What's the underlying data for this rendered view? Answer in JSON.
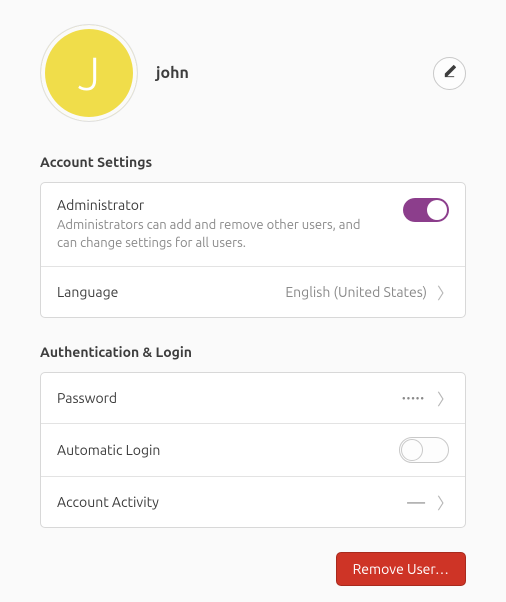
{
  "profile": {
    "avatar_letter": "J",
    "username": "john"
  },
  "sections": {
    "account": {
      "title": "Account Settings",
      "admin": {
        "label": "Administrator",
        "desc": "Administrators can add and remove other users, and can change settings for all users.",
        "enabled": true
      },
      "language": {
        "label": "Language",
        "value": "English (United States)"
      }
    },
    "auth": {
      "title": "Authentication & Login",
      "password": {
        "label": "Password",
        "value": "•••••"
      },
      "autologin": {
        "label": "Automatic Login",
        "enabled": false
      },
      "activity": {
        "label": "Account Activity",
        "value": "—"
      }
    }
  },
  "actions": {
    "remove_user": "Remove User…"
  }
}
